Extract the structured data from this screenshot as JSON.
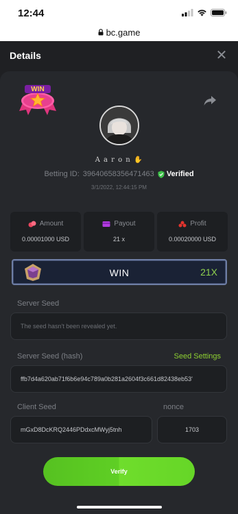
{
  "status_bar": {
    "time": "12:44"
  },
  "browser": {
    "url": "bc.game"
  },
  "header": {
    "title": "Details"
  },
  "user": {
    "name": "A a r o n",
    "betting_id_label": "Betting ID:",
    "betting_id": "396406583564714​63",
    "verified_label": "Verified",
    "date": "3/1/2022, 12:44:15 PM"
  },
  "badge": {
    "text": "WIN"
  },
  "stats": [
    {
      "label": "Amount",
      "value": "0.00001000 USD",
      "icon": "coins-icon",
      "color": "#e8465e"
    },
    {
      "label": "Payout",
      "value": "21 x",
      "icon": "wallet-icon",
      "color": "#b23ce0"
    },
    {
      "label": "Profit",
      "value": "0.00020000 USD",
      "icon": "flame-icon",
      "color": "#e2342e"
    }
  ],
  "result_banner": {
    "word": "WIN",
    "multiplier": "21X"
  },
  "server_seed": {
    "label": "Server Seed",
    "value": "The seed hasn't been revealed yet."
  },
  "server_seed_hash": {
    "label": "Server Seed (hash)",
    "link": "Seed Settings",
    "value": "ffb7d4a620ab71f6b6e94c789a0b281a2604f3c661d82438eb53'"
  },
  "client_seed": {
    "label": "Client Seed",
    "value": "mGxD8DcKRQ2446PDdxcMWyj5tnh"
  },
  "nonce": {
    "label": "nonce",
    "value": "1703"
  },
  "verify_button": {
    "label": "Verify"
  },
  "colors": {
    "accent": "#5fcf24",
    "verified": "#3fc24a",
    "background": "#1f2023",
    "card": "#26282c"
  }
}
